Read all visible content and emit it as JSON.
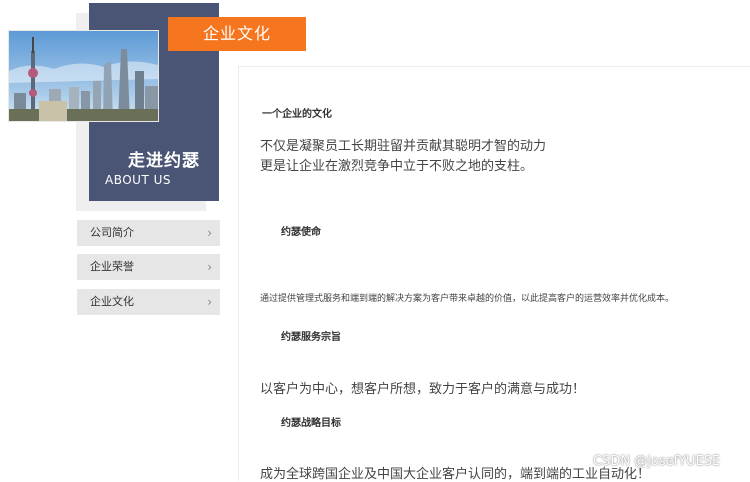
{
  "tab": {
    "label": "企业文化"
  },
  "about": {
    "title_cn": "走进约瑟",
    "title_en": "ABOUT US"
  },
  "sidebar": {
    "items": [
      {
        "label": "公司简介",
        "icon": "chevron-right-icon"
      },
      {
        "label": "企业荣誉",
        "icon": "chevron-right-icon"
      },
      {
        "label": "企业文化",
        "icon": "chevron-right-icon"
      }
    ]
  },
  "content": {
    "section_title": "一个企业的文化",
    "intro_line1": "不仅是凝聚员工长期驻留并贡献其聪明才智的动力",
    "intro_line2": "更是让企业在激烈竞争中立于不败之地的支柱。",
    "mission_title": "约瑟使命",
    "mission_text": "通过提供管理式服务和端到端的解决方案为客户带来卓越的价值，以此提高客户的运营效率并优化成本。",
    "service_title": "约瑟服务宗旨",
    "service_text": "以客户为中心，想客户所想，致力于客户的满意与成功！",
    "strategy_title": "约瑟战略目标",
    "strategy_text": "成为全球跨国企业及中国大企业客户认同的，端到端的工业自动化！"
  },
  "watermark": "CSDN @josefYUESE",
  "colors": {
    "accent": "#f5761e",
    "panel": "#4a5475",
    "sidebar_bg": "#e6e6e6"
  }
}
